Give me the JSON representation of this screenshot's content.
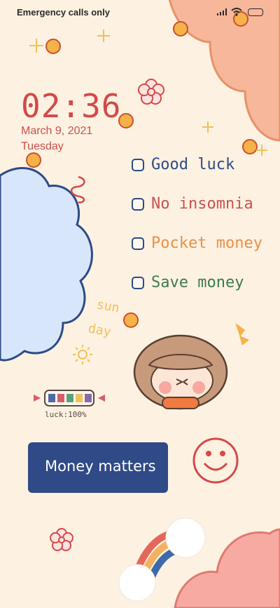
{
  "status_bar": {
    "carrier": "Emergency calls only",
    "icons": [
      "signal-icon",
      "wifi-icon",
      "battery-icon"
    ]
  },
  "lock_screen": {
    "time": "02:36",
    "date": "March 9, 2021",
    "weekday": "Tuesday"
  },
  "todo_list": [
    {
      "label": "Good luck",
      "color": "#2d4b86",
      "checked": false
    },
    {
      "label": "No insomnia",
      "color": "#c8524f",
      "checked": false
    },
    {
      "label": "Pocket money",
      "color": "#e8914a",
      "checked": false
    },
    {
      "label": "Save money",
      "color": "#3d7a52",
      "checked": false
    }
  ],
  "doodles": {
    "sunday_line1": "sun",
    "sunday_line2": "day",
    "luck_meter_label": "luck:100%",
    "luck_meter_level": 1.0,
    "banner_text": "Money matters"
  },
  "colors": {
    "background": "#fdf1e1",
    "accent_red": "#cf4b4b",
    "accent_navy": "#2f4a86",
    "cloud_blue": "#d8e6fb",
    "cloud_peach": "#f6b79a",
    "cloud_pink": "#f7aaa2"
  }
}
